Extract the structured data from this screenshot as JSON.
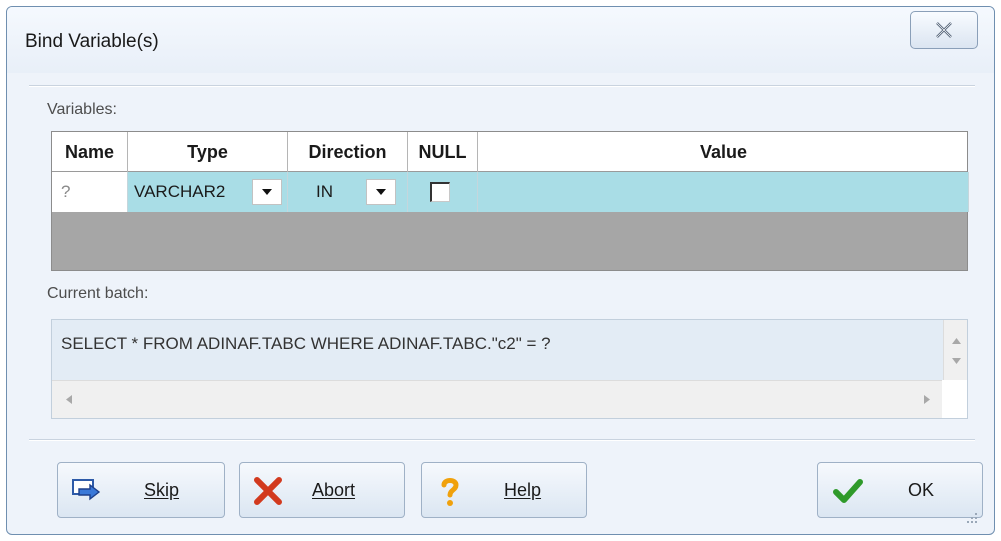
{
  "window": {
    "title": "Bind Variable(s)",
    "close_icon": "close-icon"
  },
  "variables": {
    "section_label": "Variables:",
    "columns": [
      "Name",
      "Type",
      "Direction",
      "NULL",
      "Value"
    ],
    "rows": [
      {
        "name": "?",
        "type": "VARCHAR2",
        "direction": "IN",
        "null_checked": false,
        "value": ""
      }
    ]
  },
  "batch": {
    "section_label": "Current batch:",
    "sql": "SELECT * FROM ADINAF.TABC WHERE ADINAF.TABC.\"c2\" = ?"
  },
  "buttons": {
    "skip": {
      "label": "Skip",
      "icon": "skip-arrow-icon"
    },
    "abort": {
      "label": "Abort",
      "icon": "red-x-icon"
    },
    "help": {
      "label": "Help",
      "icon": "question-mark-icon"
    },
    "ok": {
      "label": "OK",
      "icon": "green-checkmark-icon"
    }
  },
  "colors": {
    "selected_row": "#a9dde6",
    "grid_empty": "#a6a6a6",
    "window_bg": "#eef3fa"
  }
}
